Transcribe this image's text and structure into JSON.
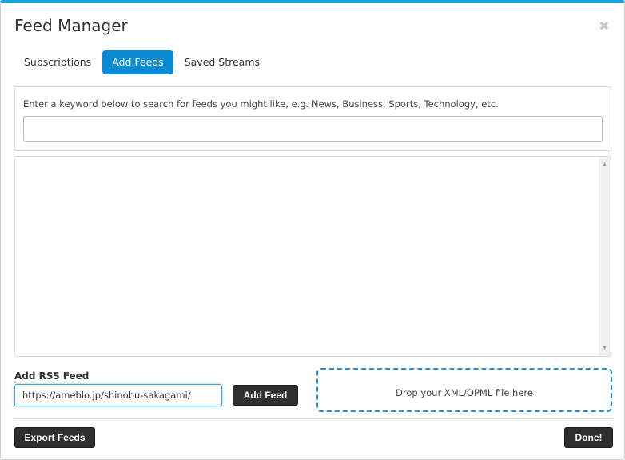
{
  "window": {
    "title": "Feed Manager",
    "close_icon": "close-icon",
    "accent_color": "#1aa3d6"
  },
  "tabs": [
    {
      "label": "Subscriptions",
      "active": false
    },
    {
      "label": "Add Feeds",
      "active": true
    },
    {
      "label": "Saved Streams",
      "active": false
    }
  ],
  "search": {
    "hint": "Enter a keyword below to search for feeds you might like, e.g. News, Business, Sports, Technology, etc.",
    "value": "",
    "placeholder": ""
  },
  "add_rss": {
    "label": "Add RSS Feed",
    "value": "https://ameblo.jp/shinobu-sakagami/",
    "button_label": "Add Feed"
  },
  "dropzone": {
    "text": "Drop your XML/OPML file here"
  },
  "footer": {
    "export_label": "Export Feeds",
    "done_label": "Done!"
  },
  "colors": {
    "active_tab": "#0b8bd3",
    "dark_button": "#2f2f2f",
    "dropzone_border": "#1b8fd8"
  }
}
